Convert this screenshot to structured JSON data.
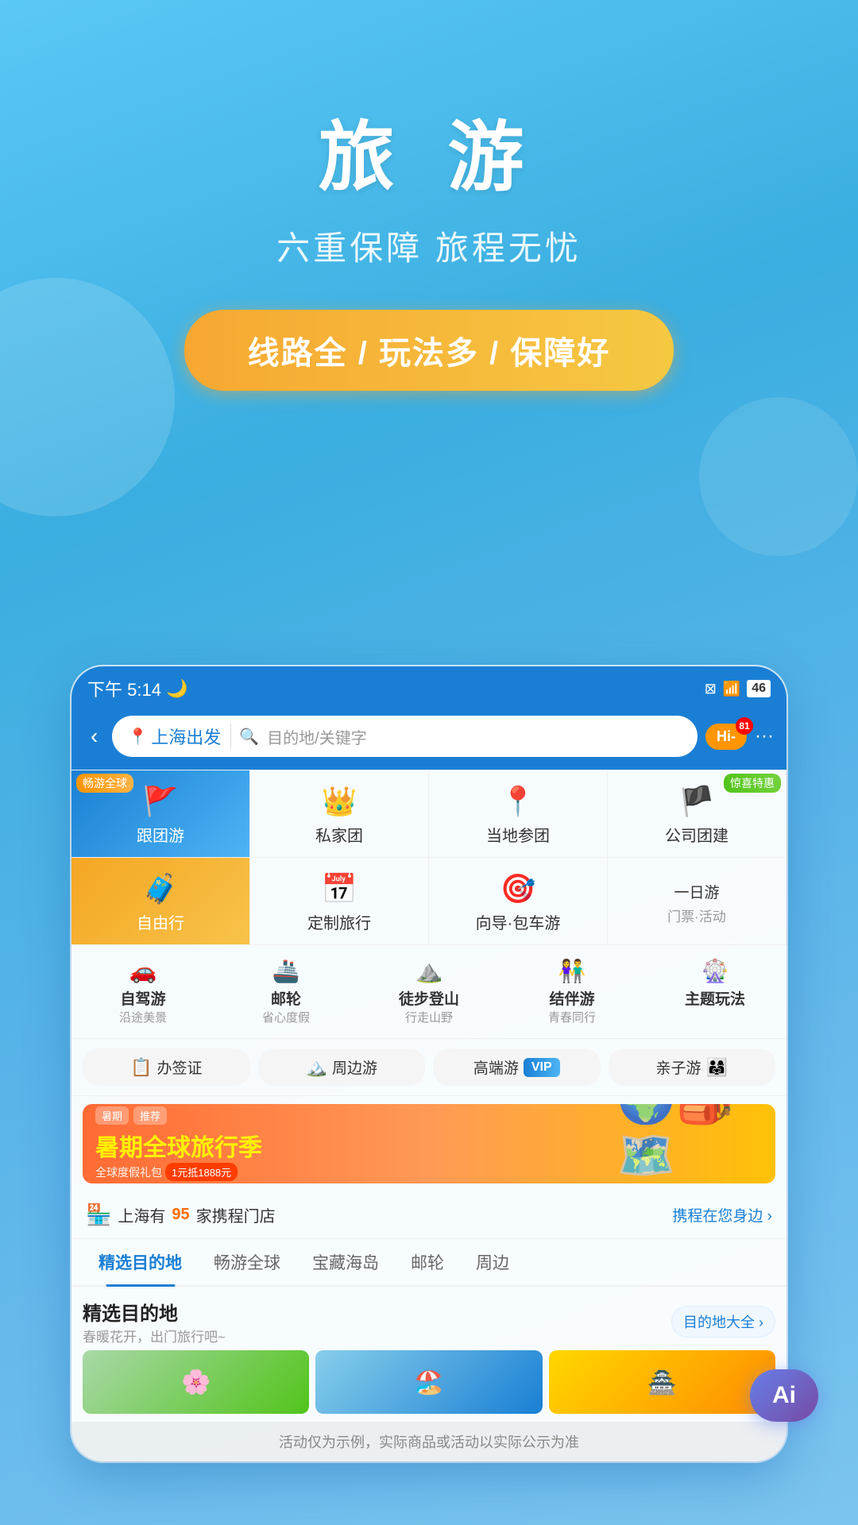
{
  "hero": {
    "title": "旅 游",
    "subtitle": "六重保障 旅程无忧",
    "badge": "线路全 / 玩法多 / 保障好"
  },
  "status_bar": {
    "time": "下午 5:14",
    "moon_icon": "🌙",
    "battery": "46",
    "wifi": "WiFi",
    "signal": "📶"
  },
  "search": {
    "back_label": "‹",
    "location": "上海出发",
    "placeholder": "目的地/关键字"
  },
  "header_right": {
    "hi_label": "Hi-",
    "badge_count": "81",
    "dots": "···"
  },
  "menu_items": [
    {
      "id": "group-tour",
      "label": "跟团游",
      "icon": "🚩",
      "bg": "blue",
      "badge_left": "畅游全球"
    },
    {
      "id": "private-tour",
      "label": "私家团",
      "icon": "👑",
      "bg": "white"
    },
    {
      "id": "local-tour",
      "label": "当地参团",
      "icon": "📍",
      "bg": "white"
    },
    {
      "id": "company-tour",
      "label": "公司团建",
      "icon": "🏴",
      "bg": "white",
      "badge_right": "惊喜特惠"
    },
    {
      "id": "free-tour",
      "label": "自由行",
      "icon": "🧳",
      "bg": "orange"
    },
    {
      "id": "custom-tour",
      "label": "定制旅行",
      "icon": "🗓️",
      "bg": "white"
    },
    {
      "id": "guide-tour",
      "label": "向导·包车游",
      "icon": "👄",
      "bg": "white"
    },
    {
      "id": "day-tour",
      "label": "一日游\n门票·活动",
      "icon": "",
      "bg": "white"
    }
  ],
  "sub_menu": [
    {
      "main": "自驾游",
      "sub": "沿途美景",
      "icon": "🚗"
    },
    {
      "main": "邮轮",
      "sub": "省心度假",
      "icon": "🚢"
    },
    {
      "main": "徒步登山",
      "sub": "行走山野",
      "icon": "⛰️"
    },
    {
      "main": "结伴游",
      "sub": "青春同行",
      "icon": "👫"
    },
    {
      "main": "主题玩法",
      "sub": "",
      "icon": "🎠"
    }
  ],
  "tags": [
    {
      "label": "办签证",
      "icon": "📄"
    },
    {
      "label": "周边游",
      "icon": "🏔️"
    },
    {
      "label": "高端游",
      "icon": "VIP"
    },
    {
      "label": "亲子游",
      "icon": "👨‍👩‍👧"
    }
  ],
  "banner": {
    "corner_label": "暑期全球旅行季",
    "main_text": "暑期全球旅行季",
    "sub_text": "全球度假礼包",
    "coupon": "1元抵1888元",
    "icon": "🌍"
  },
  "store_info": {
    "text_before": "上海有",
    "count": "95",
    "text_after": "家携程门店",
    "link": "携程在您身边 ›",
    "icon": "🏪"
  },
  "tabs": [
    {
      "label": "精选目的地",
      "active": true
    },
    {
      "label": "畅游全球",
      "active": false
    },
    {
      "label": "宝藏海岛",
      "active": false
    },
    {
      "label": "邮轮",
      "active": false
    },
    {
      "label": "周边",
      "active": false
    }
  ],
  "destination": {
    "title": "精选目的地",
    "subtitle": "春暖花开，出门旅行吧~",
    "all_btn": "目的地大全 ›"
  },
  "disclaimer": "活动仅为示例，实际商品或活动以实际公示为准",
  "ai_button": "Ai"
}
